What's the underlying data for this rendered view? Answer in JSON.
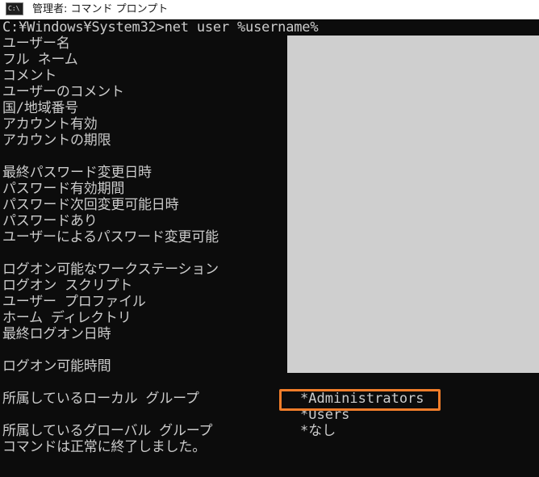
{
  "window": {
    "title": "管理者: コマンド プロンプト",
    "icon_name": "console-icon",
    "icon_glyph": "C:\\"
  },
  "console": {
    "command_line": "C:¥Windows¥System32>net user %username%",
    "labels": [
      "ユーザー名",
      "フル ネーム",
      "コメント",
      "ユーザーのコメント",
      "国/地域番号",
      "アカウント有効",
      "アカウントの期限",
      "最終パスワード変更日時",
      "パスワード有効期間",
      "パスワード次回変更可能日時",
      "パスワードあり",
      "ユーザーによるパスワード変更可能",
      "ログオン可能なワークステーション",
      "ログオン スクリプト",
      "ユーザー プロファイル",
      "ホーム ディレクトリ",
      "最終ログオン日時",
      "ログオン可能時間",
      "所属しているローカル グループ",
      "所属しているグローバル グループ",
      "コマンドは正常に終了しました。"
    ],
    "local_groups": [
      "*Administrators",
      "*Users"
    ],
    "global_groups": [
      "*なし"
    ]
  },
  "annotation": {
    "highlight_color": "#f07d2a",
    "redaction_color": "#cfcfcf"
  }
}
